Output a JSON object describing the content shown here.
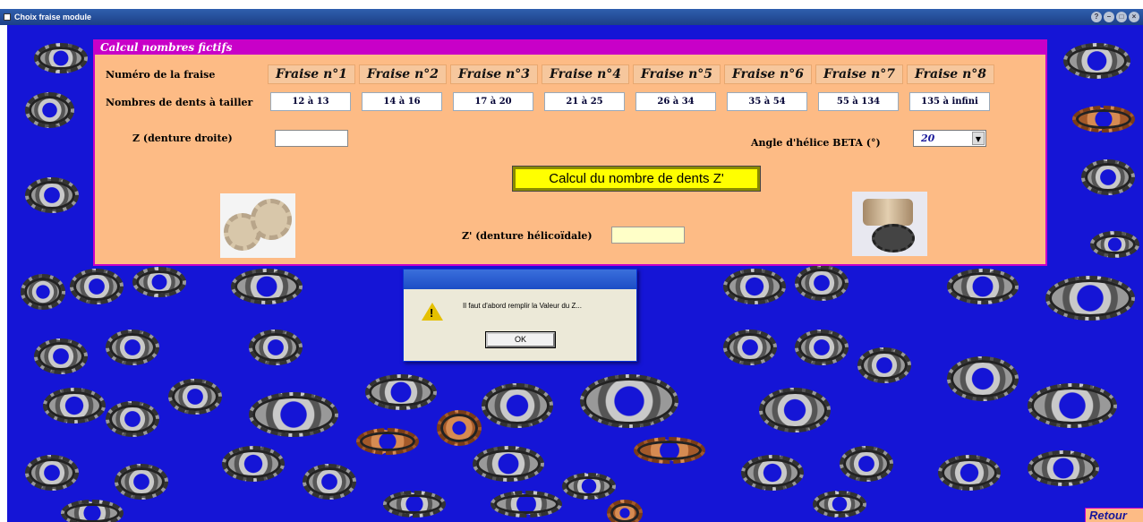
{
  "window": {
    "title": "Choix fraise module"
  },
  "panel": {
    "header": "Calcul nombres fictifs",
    "row1_label": "Numéro de la fraise",
    "row2_label": "Nombres de dents à tailler",
    "fraises": [
      {
        "name": "Fraise n°1",
        "teeth": "12 à 13"
      },
      {
        "name": "Fraise n°2",
        "teeth": "14 à 16"
      },
      {
        "name": "Fraise n°3",
        "teeth": "17 à 20"
      },
      {
        "name": "Fraise n°4",
        "teeth": "21 à 25"
      },
      {
        "name": "Fraise n°5",
        "teeth": "26 à 34"
      },
      {
        "name": "Fraise n°6",
        "teeth": "35 à 54"
      },
      {
        "name": "Fraise n°7",
        "teeth": "55 à 134"
      },
      {
        "name": "Fraise n°8",
        "teeth": "135 à infini"
      }
    ],
    "z_label": "Z  (denture droite)",
    "z_value": "",
    "beta_label": "Angle d'hélice BETA (°)",
    "beta_value": "20",
    "calc_button": "Calcul du nombre de  dents Z'",
    "zprime_label": "Z' (denture hélicoïdale)",
    "zprime_value": ""
  },
  "dialog": {
    "message": "Il faut d'abord remplir la Valeur du Z...",
    "ok_label": "OK"
  },
  "retour_label": "Retour"
}
